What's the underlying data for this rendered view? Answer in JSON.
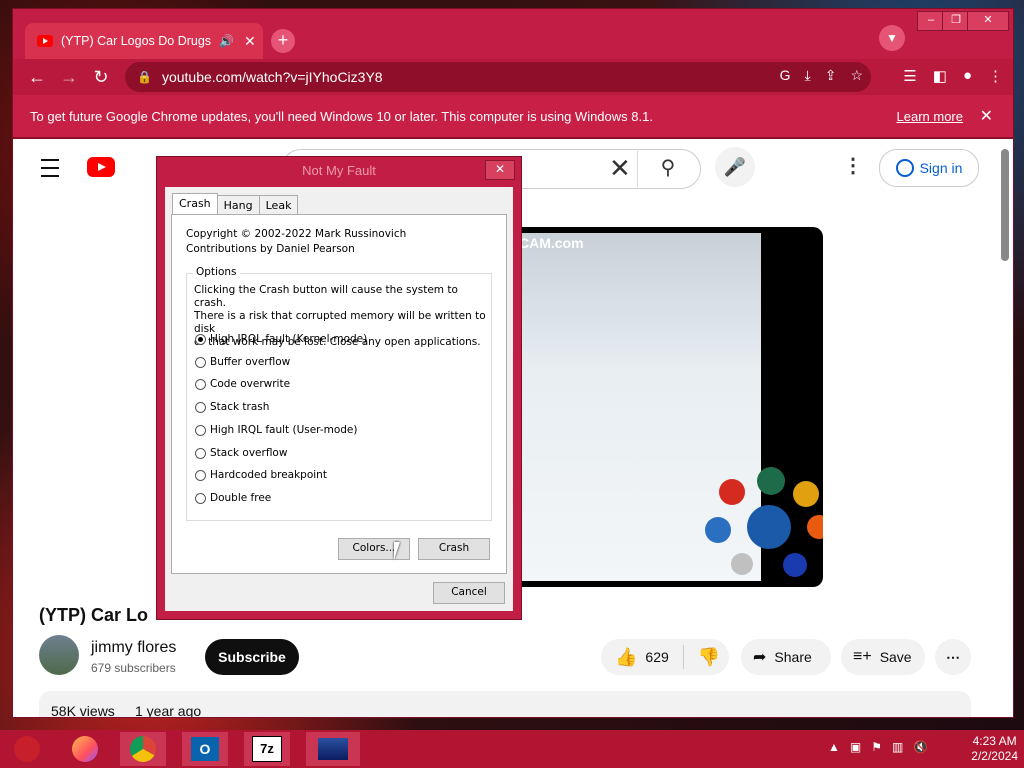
{
  "browser": {
    "tab_title": "(YTP) Car Logos Do Drugs (R",
    "new_tab": "+",
    "url": "youtube.com/watch?v=jIYhoCiz3Y8",
    "infobar_message": "To get future Google Chrome updates, you'll need Windows 10 or later. This computer is using Windows 8.1.",
    "infobar_link": "Learn more"
  },
  "youtube": {
    "sign_in": "Sign in",
    "video_title": "(YTP) Car Lo",
    "channel_name": "jimmy flores",
    "subscribers": "679 subscribers",
    "subscribe": "Subscribe",
    "likes": "629",
    "share": "Share",
    "save": "Save",
    "views": "58K views",
    "age": "1 year ago",
    "video_overlay_text": "CAM.com"
  },
  "dialog": {
    "title": "Not My Fault",
    "tabs": [
      "Crash",
      "Hang",
      "Leak"
    ],
    "copyright": "Copyright © 2002-2022 Mark Russinovich",
    "contributions": "Contributions by Daniel Pearson",
    "options_label": "Options",
    "options_desc_1": "Clicking the Crash button will cause the system to crash.",
    "options_desc_2": "There is a risk that corrupted memory will be written to disk",
    "options_desc_3": "or that work may be lost. Close any open applications.",
    "options": [
      "High IRQL fault (Kernel-mode)",
      "Buffer overflow",
      "Code overwrite",
      "Stack trash",
      "High IRQL fault (User-mode)",
      "Stack overflow",
      "Hardcoded breakpoint",
      "Double free"
    ],
    "selected_option": "High IRQL fault (Kernel-mode)",
    "colors_button": "Colors...",
    "crash_button": "Crash",
    "cancel_button": "Cancel"
  },
  "taskbar": {
    "time": "4:23 AM",
    "date": "2/2/2024",
    "apps": [
      "start-orb",
      "firefox",
      "chrome",
      "outlook",
      "7zip",
      "notmyfault"
    ]
  },
  "colors": {
    "chrome_frame": "#c21d44",
    "taskbar": "#b11531",
    "youtube_red": "#ff0000",
    "link_blue": "#065fd4"
  }
}
